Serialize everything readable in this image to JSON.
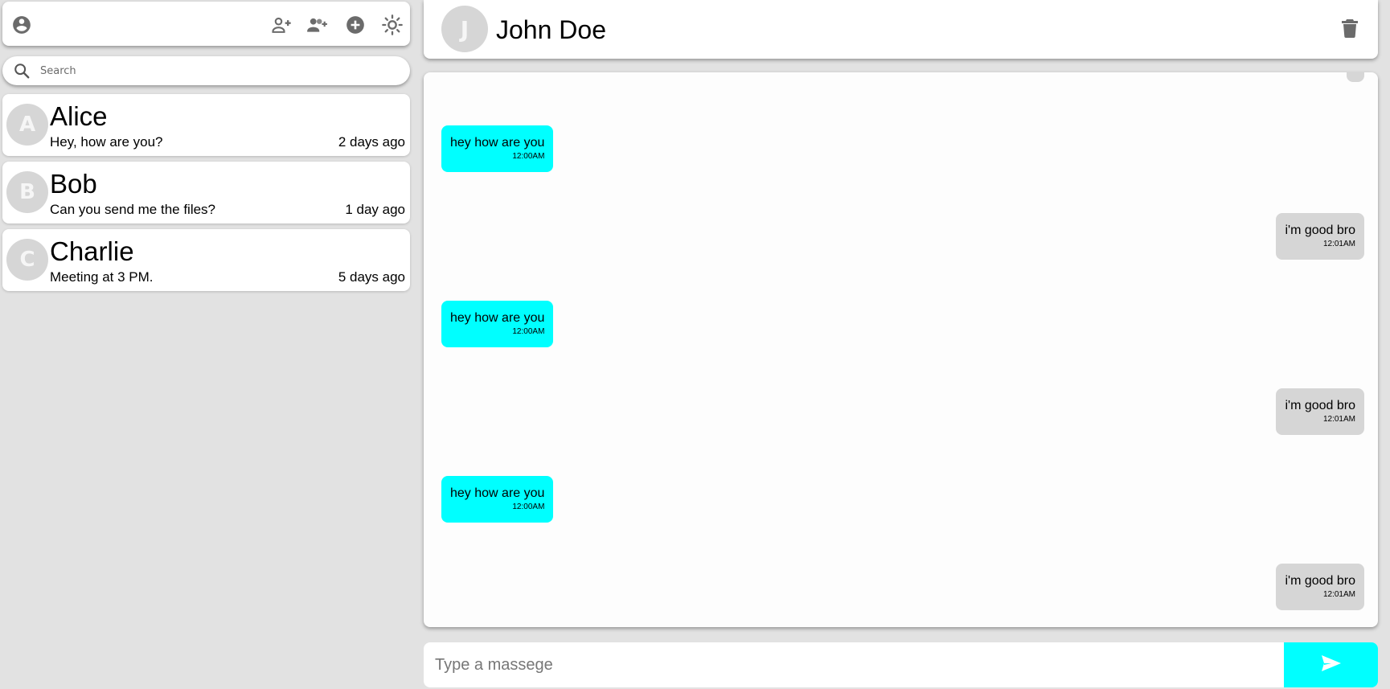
{
  "sidebar": {
    "search": {
      "placeholder": "Search"
    },
    "chats": [
      {
        "initial": "A",
        "name": "Alice",
        "preview": "Hey, how are you?",
        "time": "2 days ago"
      },
      {
        "initial": "B",
        "name": "Bob",
        "preview": "Can you send me the files?",
        "time": "1 day ago"
      },
      {
        "initial": "C",
        "name": "Charlie",
        "preview": "Meeting at 3 PM.",
        "time": "5 days ago"
      }
    ]
  },
  "header": {
    "initial": "J",
    "name": "John Doe"
  },
  "messages": [
    {
      "from": "me",
      "text": "hey how are you",
      "time": "12:00AM"
    },
    {
      "from": "them",
      "text": "i'm good bro",
      "time": "12:01AM"
    },
    {
      "from": "me",
      "text": "hey how are you",
      "time": "12:00AM"
    },
    {
      "from": "them",
      "text": "i'm good bro",
      "time": "12:01AM"
    },
    {
      "from": "me",
      "text": "hey how are you",
      "time": "12:00AM"
    },
    {
      "from": "them",
      "text": "i'm good bro",
      "time": "12:01AM"
    }
  ],
  "composer": {
    "placeholder": "Type a massege"
  },
  "colors": {
    "accent": "#00ffff",
    "received_bubble": "#d6d6d6",
    "background": "#e2e2e2",
    "icon": "#6b6b6b"
  },
  "icons": {
    "profile": "account-circle-icon",
    "add_user": "person-add-icon",
    "add_group": "group-add-icon",
    "new_chat": "add-circle-icon",
    "theme": "sun-icon",
    "search": "search-icon",
    "delete": "trash-icon",
    "send": "send-icon"
  }
}
